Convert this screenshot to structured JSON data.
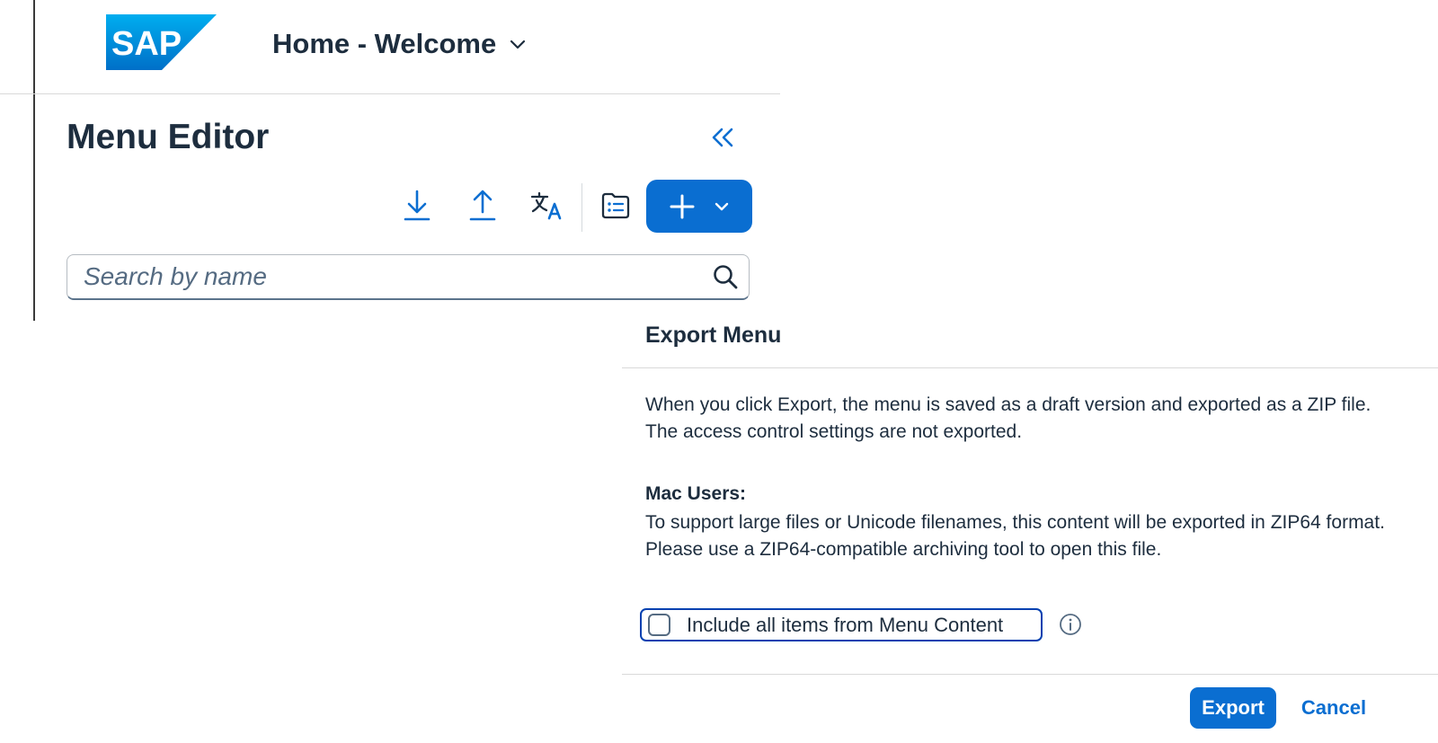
{
  "shell": {
    "logo_text": "SAP",
    "app_title": "Home - Welcome"
  },
  "page": {
    "title": "Menu Editor"
  },
  "toolbar": {
    "icons": [
      "download-icon",
      "upload-icon",
      "translate-icon",
      "folder-list-icon",
      "add-icon",
      "chevron-down-icon"
    ]
  },
  "search": {
    "placeholder": "Search by name",
    "value": ""
  },
  "dialog": {
    "title": "Export Menu",
    "description": "When you click Export, the menu is saved as a draft version and exported as a ZIP file. The access control settings are not exported.",
    "mac_heading": "Mac Users:",
    "mac_text": "To support large files or Unicode filenames, this content will be exported in ZIP64 format. Please use a ZIP64-compatible archiving tool to open this file.",
    "checkbox_label": "Include all items from Menu Content",
    "checkbox_checked": false,
    "export_label": "Export",
    "cancel_label": "Cancel"
  },
  "colors": {
    "accent": "#0a6ed1",
    "text": "#1d2d3e",
    "focus": "#0040b0"
  }
}
